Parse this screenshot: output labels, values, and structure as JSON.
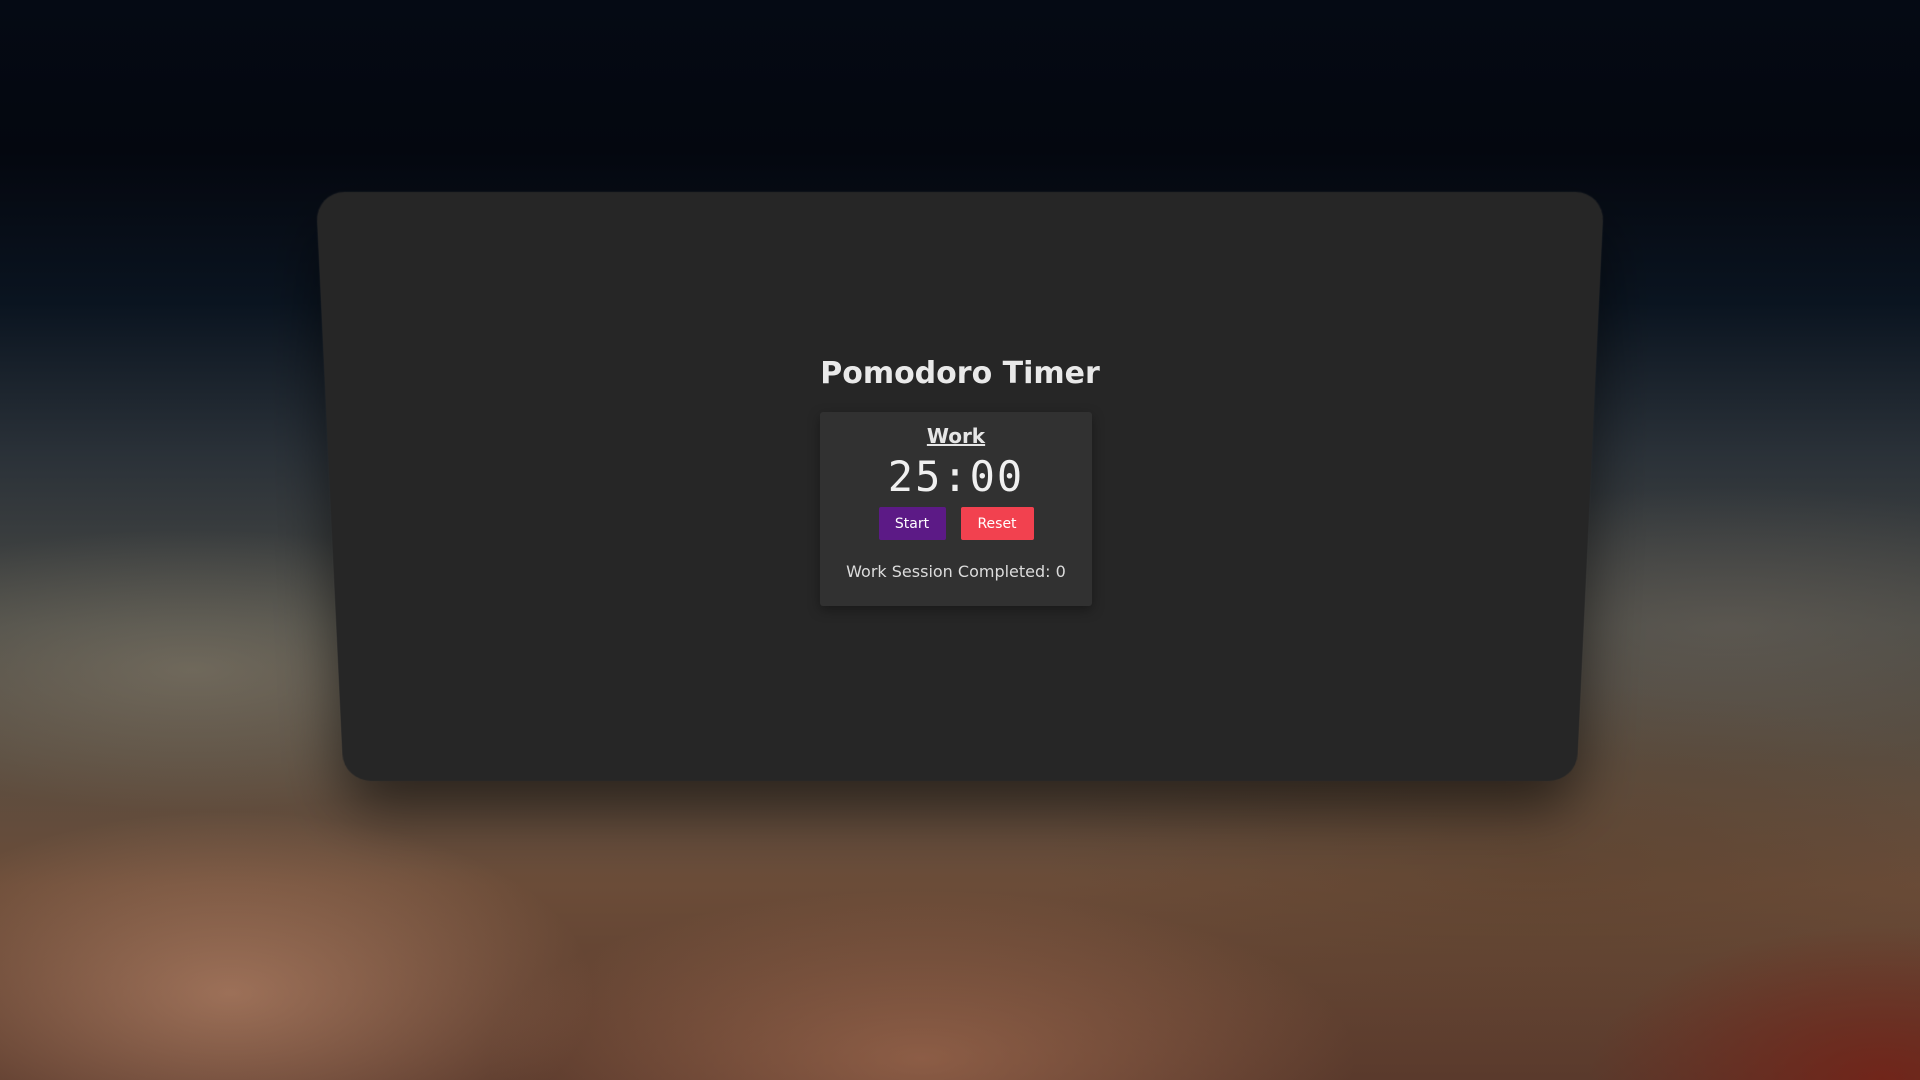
{
  "app": {
    "title": "Pomodoro Timer"
  },
  "timer": {
    "mode": "Work",
    "time": "25:00",
    "start_label": "Start",
    "reset_label": "Reset",
    "sessions_text": "Work Session Completed: 0"
  },
  "colors": {
    "card_background": "#262626",
    "panel_background": "#313131",
    "start_button": "#5c1a86",
    "reset_button": "#f2414f",
    "text": "#e9e9e9"
  }
}
